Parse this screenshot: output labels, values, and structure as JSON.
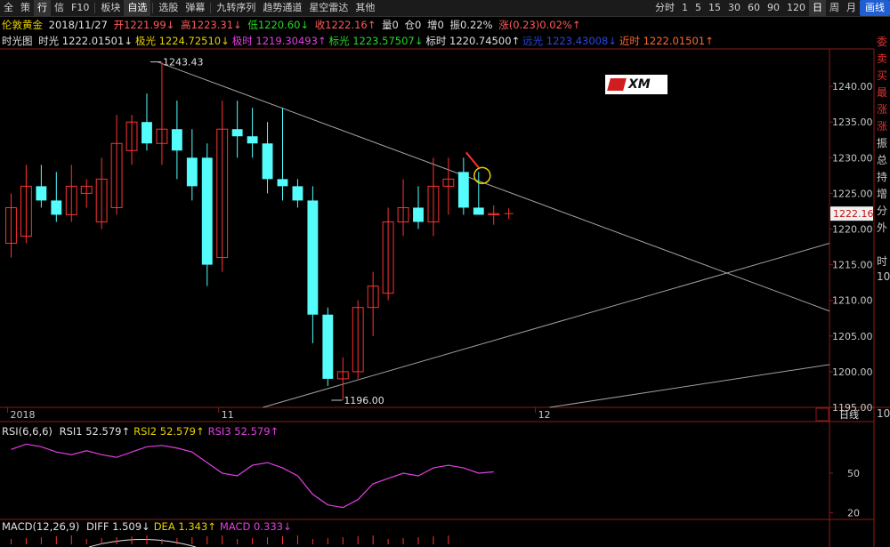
{
  "toolbar": {
    "items": [
      {
        "label": "全",
        "kind": "tab"
      },
      {
        "label": "策",
        "kind": "tab"
      },
      {
        "label": "行",
        "kind": "tab-active"
      },
      {
        "label": "信",
        "kind": "tab"
      },
      {
        "label": "F10",
        "kind": "tab"
      },
      {
        "label": "板块",
        "kind": "menu"
      },
      {
        "label": "自选",
        "kind": "menu-active"
      },
      {
        "label": "选股",
        "kind": "menu"
      },
      {
        "label": "弹幕",
        "kind": "menu"
      },
      {
        "label": "九转序列",
        "kind": "menu"
      },
      {
        "label": "趋势通道",
        "kind": "menu"
      },
      {
        "label": "星空雷达",
        "kind": "menu"
      },
      {
        "label": "其他",
        "kind": "menu"
      }
    ],
    "periods": [
      "分时",
      "1",
      "5",
      "15",
      "30",
      "60",
      "90",
      "120",
      "日",
      "周",
      "月"
    ],
    "selected_period": "日",
    "right_button": "画线"
  },
  "info_bar": {
    "name": "伦敦黄金",
    "date": "2018/11/27",
    "open": "开1221.99↓",
    "high": "高1223.31↓",
    "low": "低1220.60↓",
    "close": "收1222.16↑",
    "volume": "量0",
    "position": "仓0",
    "increase": "增0",
    "amplitude": "振0.22%",
    "change": "涨(0.23)0.02%↑"
  },
  "ma_bar": {
    "label": "时光图",
    "items": [
      {
        "text": "时光 1222.01501↓",
        "color": "#e0e0e0"
      },
      {
        "text": "极光 1224.72510↓",
        "color": "#e8d000"
      },
      {
        "text": "极时 1219.30493↑",
        "color": "#e040e0"
      },
      {
        "text": "标光 1223.57507↓",
        "color": "#28d728"
      },
      {
        "text": "标时 1220.74500↑",
        "color": "#e0e0e0"
      },
      {
        "text": "远光 1223.43008↓",
        "color": "#2a45e0"
      },
      {
        "text": "近时 1222.01501↑",
        "color": "#ff6a2a"
      }
    ]
  },
  "side_panel": [
    "委",
    "卖",
    "买",
    "最",
    "涨",
    "涨",
    "振",
    "总",
    "持",
    "增",
    "分",
    "外"
  ],
  "right_edge": {
    "t1": "时",
    "t2": "10",
    "t3": "10"
  },
  "logo": {
    "text": "XM"
  },
  "chart_data": {
    "type": "candlestick",
    "ylim": [
      1195,
      1245
    ],
    "yticks": [
      1195,
      1200,
      1205,
      1210,
      1215,
      1220,
      1225,
      1230,
      1235,
      1240
    ],
    "ytick_labels": [
      "1195.00",
      "1200.00",
      "1205.00",
      "1210.00",
      "1215.00",
      "1220.00",
      "1225.00",
      "1230.00",
      "1235.00",
      "1240.00"
    ],
    "xaxis_labels": [
      {
        "index": 0,
        "label": "2018"
      },
      {
        "index": 14,
        "label": "11"
      },
      {
        "index": 35,
        "label": "12"
      }
    ],
    "x_slots": 55,
    "current_price": "1222.16",
    "annotations": [
      {
        "index": 9,
        "value": 1243.43,
        "label": "1243.43"
      },
      {
        "index": 21,
        "value": 1196.0,
        "label": "1196.00"
      }
    ],
    "candles": [
      {
        "o": 1218,
        "h": 1225,
        "l": 1216,
        "c": 1223
      },
      {
        "o": 1219,
        "h": 1229,
        "l": 1218,
        "c": 1226
      },
      {
        "o": 1226,
        "h": 1229,
        "l": 1223,
        "c": 1224
      },
      {
        "o": 1224,
        "h": 1228,
        "l": 1221,
        "c": 1222
      },
      {
        "o": 1222,
        "h": 1229,
        "l": 1221,
        "c": 1226
      },
      {
        "o": 1225,
        "h": 1227,
        "l": 1223,
        "c": 1226
      },
      {
        "o": 1221,
        "h": 1230,
        "l": 1220,
        "c": 1227
      },
      {
        "o": 1223,
        "h": 1236,
        "l": 1222,
        "c": 1232
      },
      {
        "o": 1231,
        "h": 1236,
        "l": 1229,
        "c": 1235
      },
      {
        "o": 1235,
        "h": 1239,
        "l": 1231,
        "c": 1232
      },
      {
        "o": 1232,
        "h": 1243.43,
        "l": 1229,
        "c": 1234
      },
      {
        "o": 1234,
        "h": 1238,
        "l": 1227,
        "c": 1231
      },
      {
        "o": 1230,
        "h": 1234,
        "l": 1224,
        "c": 1226
      },
      {
        "o": 1230,
        "h": 1232,
        "l": 1212,
        "c": 1215
      },
      {
        "o": 1216,
        "h": 1238,
        "l": 1214,
        "c": 1234
      },
      {
        "o": 1234,
        "h": 1238,
        "l": 1230,
        "c": 1233
      },
      {
        "o": 1233,
        "h": 1237,
        "l": 1230,
        "c": 1232
      },
      {
        "o": 1232,
        "h": 1235,
        "l": 1225,
        "c": 1227
      },
      {
        "o": 1227,
        "h": 1237,
        "l": 1224,
        "c": 1226
      },
      {
        "o": 1226,
        "h": 1227,
        "l": 1223,
        "c": 1224
      },
      {
        "o": 1224,
        "h": 1226,
        "l": 1204,
        "c": 1208
      },
      {
        "o": 1208,
        "h": 1209,
        "l": 1198,
        "c": 1199
      },
      {
        "o": 1199,
        "h": 1202,
        "l": 1196.0,
        "c": 1200
      },
      {
        "o": 1200,
        "h": 1210,
        "l": 1199,
        "c": 1209
      },
      {
        "o": 1209,
        "h": 1214,
        "l": 1205,
        "c": 1212
      },
      {
        "o": 1211,
        "h": 1223,
        "l": 1210,
        "c": 1221
      },
      {
        "o": 1221,
        "h": 1227,
        "l": 1219,
        "c": 1223
      },
      {
        "o": 1223,
        "h": 1226,
        "l": 1220,
        "c": 1221
      },
      {
        "o": 1221,
        "h": 1230,
        "l": 1219,
        "c": 1226
      },
      {
        "o": 1226,
        "h": 1230,
        "l": 1222,
        "c": 1227
      },
      {
        "o": 1228,
        "h": 1230,
        "l": 1222,
        "c": 1223
      },
      {
        "o": 1223,
        "h": 1228,
        "l": 1222,
        "c": 1222
      },
      {
        "o": 1222,
        "h": 1223.31,
        "l": 1220.6,
        "c": 1222.16
      }
    ],
    "trendlines": [
      {
        "p1": {
          "index": 10,
          "value": 1243.43
        },
        "p2": {
          "index": 55,
          "value": 1208.5
        },
        "color": "#a0a0a0"
      },
      {
        "p1": {
          "index": 17,
          "value": 1195
        },
        "p2": {
          "index": 55,
          "value": 1218
        },
        "color": "#a0a0a0"
      },
      {
        "p1": {
          "index": 36,
          "value": 1195
        },
        "p2": {
          "index": 55,
          "value": 1201
        },
        "color": "#a0a0a0"
      }
    ],
    "rsi": {
      "title": "RSI(6,6,6)",
      "labels": [
        {
          "text": "RSI1 52.579↑",
          "color": "#e0e0e0"
        },
        {
          "text": "RSI2 52.579↑",
          "color": "#e8d000"
        },
        {
          "text": "RSI3 52.579↑",
          "color": "#e040e0"
        }
      ],
      "ylim": [
        15,
        85
      ],
      "yticks": [
        20,
        50
      ],
      "values": [
        68,
        72,
        70,
        66,
        64,
        67,
        64,
        62,
        66,
        70,
        71,
        69,
        66,
        58,
        50,
        48,
        56,
        58,
        54,
        48,
        34,
        26,
        24,
        30,
        42,
        46,
        50,
        48,
        54,
        56,
        54,
        50,
        51
      ]
    },
    "macd": {
      "title": "MACD(12,26,9)",
      "labels": [
        {
          "text": "DIFF 1.509↓",
          "color": "#e0e0e0"
        },
        {
          "text": "DEA 1.343↑",
          "color": "#e8d000"
        },
        {
          "text": "MACD 0.333↓",
          "color": "#e040e0"
        }
      ]
    }
  }
}
